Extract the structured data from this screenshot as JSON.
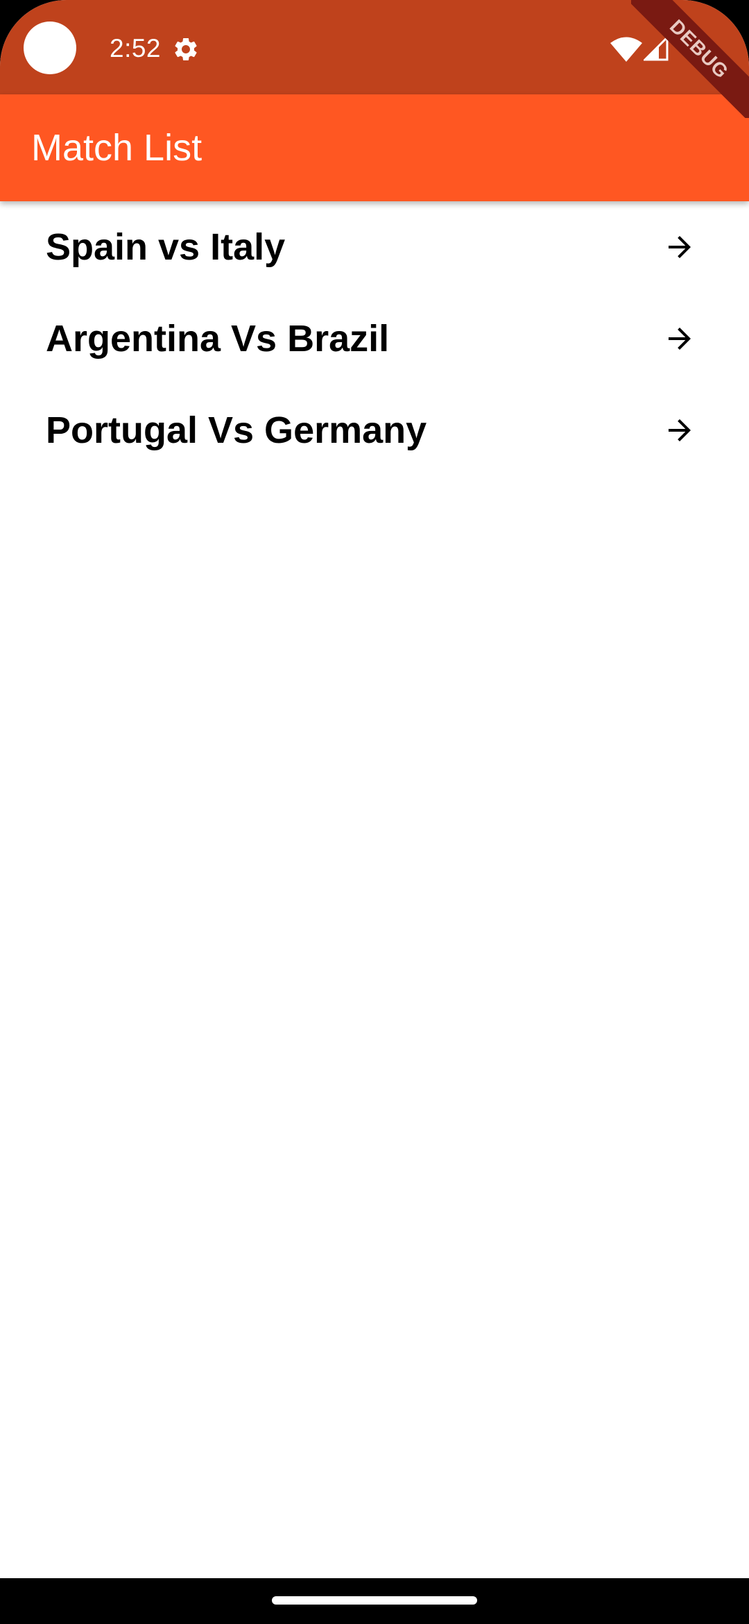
{
  "status_bar": {
    "time": "2:52",
    "icons": [
      "settings-icon",
      "wifi-icon",
      "signal-icon"
    ],
    "color": "#bf421c"
  },
  "debug_banner": {
    "label": "DEBUG"
  },
  "app_bar": {
    "title": "Match List",
    "color": "#ff5722"
  },
  "matches": [
    {
      "label": "Spain vs Italy",
      "icon": "arrow-forward-icon"
    },
    {
      "label": "Argentina Vs Brazil",
      "icon": "arrow-forward-icon"
    },
    {
      "label": "Portugal Vs Germany",
      "icon": "arrow-forward-icon"
    }
  ]
}
